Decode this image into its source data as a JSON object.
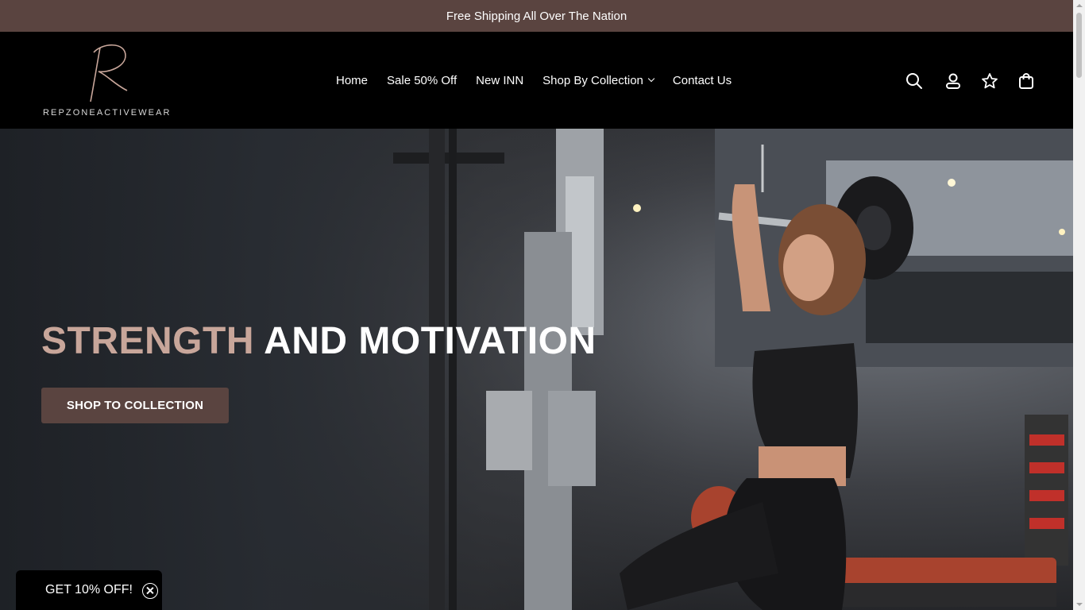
{
  "announcement": "Free Shipping All Over The Nation",
  "brand": {
    "wordmark": "REPZONEACTIVEWEAR",
    "logo_letter": "R"
  },
  "nav": {
    "home": "Home",
    "sale": "Sale 50% Off",
    "new": "New INN",
    "collection": "Shop By Collection",
    "contact": "Contact Us"
  },
  "header_icons": [
    "search-icon",
    "account-icon",
    "wishlist-star-icon",
    "cart-bag-icon"
  ],
  "hero": {
    "headline_accent": "STRENGTH",
    "headline_rest": "AND MOTIVATION",
    "cta": "SHOP TO COLLECTION",
    "image_alt": "woman training on lat pulldown machine in gym"
  },
  "promo": {
    "label": "GET 10% OFF!"
  },
  "colors": {
    "brand_brown": "#5a4440",
    "accent_rose": "#c8a69a",
    "header_bg": "#000000"
  }
}
